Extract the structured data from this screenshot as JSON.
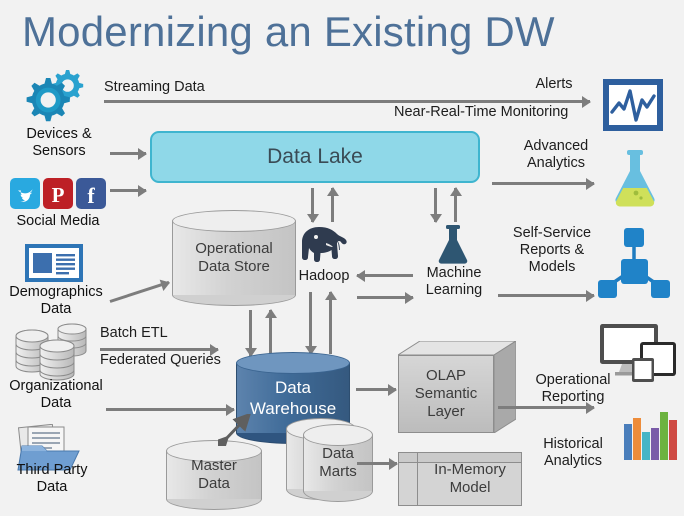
{
  "title": "Modernizing an Existing DW",
  "colors": {
    "background": "#f2f2f2",
    "title": "#4e7198",
    "data_lake_fill": "#8fd8e8",
    "data_lake_border": "#3fb5cf",
    "data_warehouse_fill": "#3f6b98",
    "arrow": "#7d7d7d",
    "accent_blue": "#2e75b6",
    "gear_teal": "#1b86b5",
    "twitter": "#29a9e0",
    "pinterest": "#bd2026",
    "facebook": "#3b5998",
    "flask_glass": "#68bfe0",
    "flask_liquid": "#cfe05a"
  },
  "sources": [
    {
      "id": "devices",
      "icon": "gears-icon",
      "label": "Devices &\nSensors"
    },
    {
      "id": "social",
      "icon": "social-media-icon",
      "label": "Social Media"
    },
    {
      "id": "demographics",
      "icon": "article-card-icon",
      "label": "Demographics\nData"
    },
    {
      "id": "organizational",
      "icon": "database-stack-icon",
      "label": "Organizational\nData"
    },
    {
      "id": "thirdparty",
      "icon": "folder-docs-icon",
      "label": "Third Party\nData"
    }
  ],
  "flows": {
    "streaming_data": "Streaming Data",
    "near_real_time": "Near-Real-Time Monitoring",
    "batch_etl": "Batch ETL",
    "federated_queries": "Federated Queries"
  },
  "core": {
    "data_lake": "Data Lake",
    "operational_data_store": "Operational\nData Store",
    "hadoop": "Hadoop",
    "machine_learning": "Machine\nLearning",
    "data_warehouse": "Data\nWarehouse",
    "master_data": "Master\nData",
    "data_marts": "Data\nMarts",
    "olap_semantic_layer": "OLAP\nSemantic\nLayer",
    "in_memory_model": "In-Memory\nModel"
  },
  "outputs": [
    {
      "id": "alerts",
      "label": "Alerts",
      "icon": "monitor-chart-icon"
    },
    {
      "id": "advanced",
      "label": "Advanced\nAnalytics",
      "icon": "flask-icon"
    },
    {
      "id": "selfservice",
      "label": "Self-Service\nReports &\nModels",
      "icon": "node-network-icon"
    },
    {
      "id": "operational",
      "label": "Operational\nReporting",
      "icon": "devices-screens-icon"
    },
    {
      "id": "historical",
      "label": "Historical\nAnalytics",
      "icon": "bar-chart-icon"
    }
  ],
  "bar_chart_colors": [
    "#4a7ebb",
    "#ed8c3a",
    "#46b5c6",
    "#7a5ba8",
    "#6cb33f",
    "#cf4a43"
  ]
}
